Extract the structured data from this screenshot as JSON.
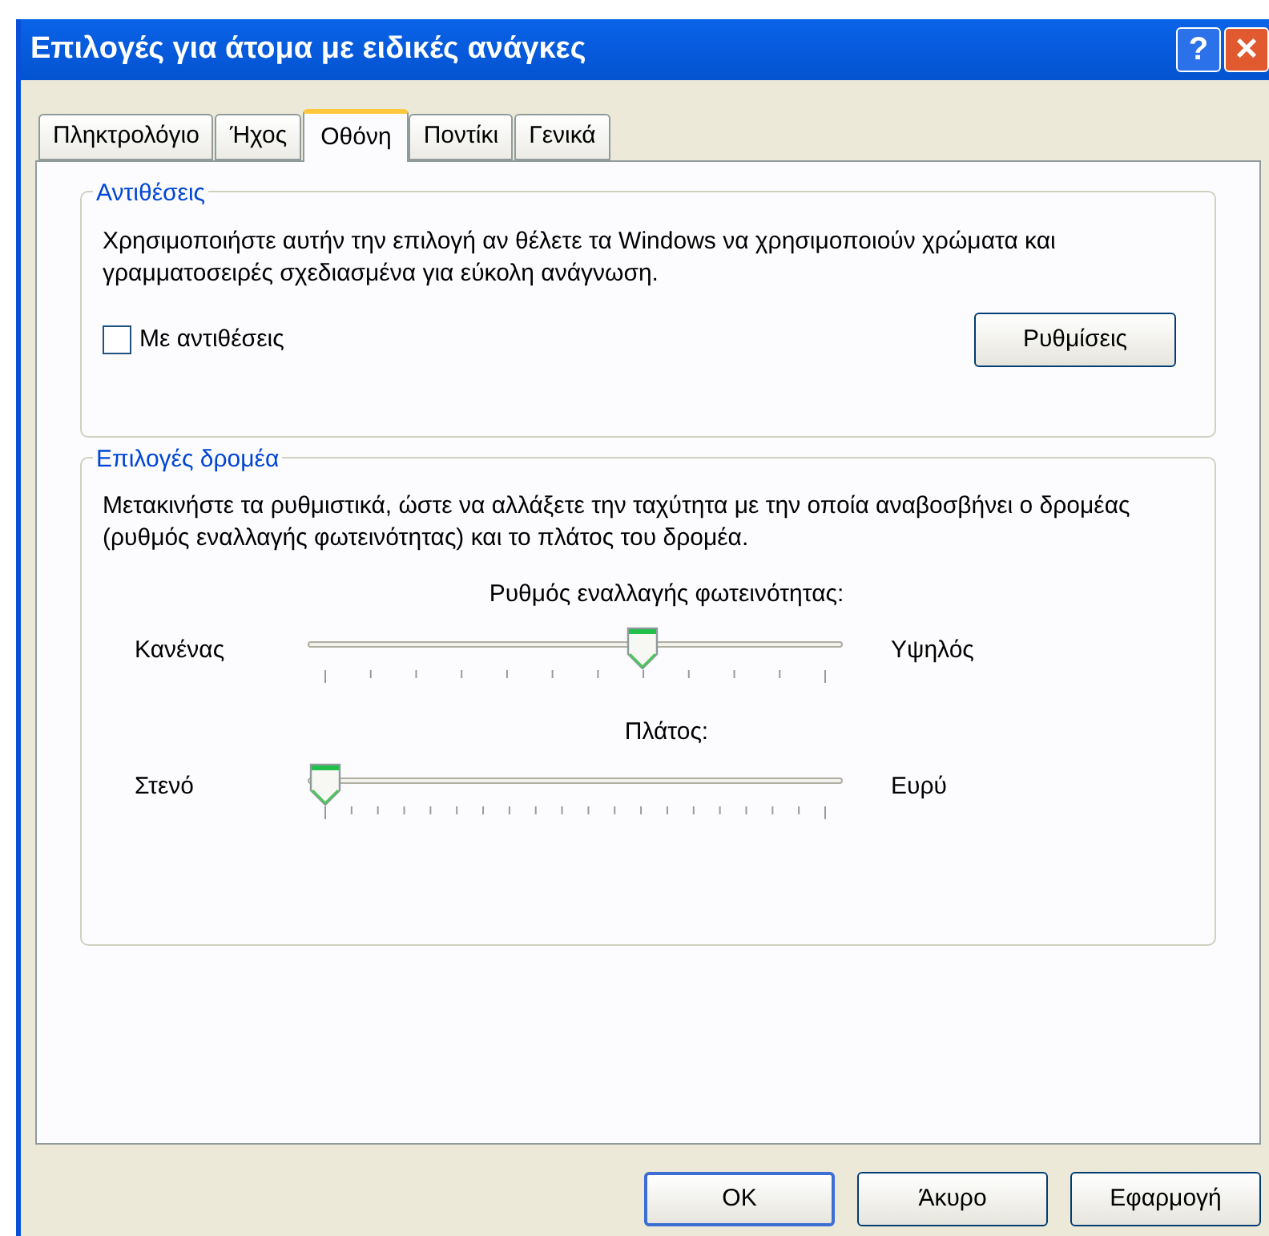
{
  "window": {
    "title": "Επιλογές για άτομα με ειδικές ανάγκες",
    "help": "?",
    "close": "×"
  },
  "tabs": [
    {
      "label": "Πληκτρολόγιο",
      "selected": false
    },
    {
      "label": "Ήχος",
      "selected": false
    },
    {
      "label": "Οθόνη",
      "selected": true
    },
    {
      "label": "Ποντίκι",
      "selected": false
    },
    {
      "label": "Γενικά",
      "selected": false
    }
  ],
  "contrast": {
    "title": "Αντιθέσεις",
    "description": "Χρησιμοποιήστε αυτήν την επιλογή αν θέλετε τα Windows να χρησιμοποιούν χρώματα και γραμματοσειρές σχεδιασμένα για εύκολη ανάγνωση.",
    "checkbox": {
      "label": "Με αντιθέσεις",
      "checked": false
    },
    "settings_button": "Ρυθμίσεις"
  },
  "cursor": {
    "title": "Επιλογές δρομέα",
    "description": "Μετακινήστε τα ρυθμιστικά, ώστε να αλλάξετε την ταχύτητα με την οποία αναβοσβήνει ο δρομέας (ρυθμός εναλλαγής φωτεινότητας) και το πλάτος του δρομέα.",
    "sliders": [
      {
        "label": "Ρυθμός εναλλαγής φωτεινότητας:",
        "min_label": "Κανένας",
        "max_label": "Υψηλός",
        "level": 0.636
      },
      {
        "label": "Πλάτος:",
        "min_label": "Στενό",
        "max_label": "Ευρύ",
        "level": 0
      }
    ]
  },
  "buttons": [
    "OK",
    "Άκυρο",
    "Εφαρμογή"
  ]
}
